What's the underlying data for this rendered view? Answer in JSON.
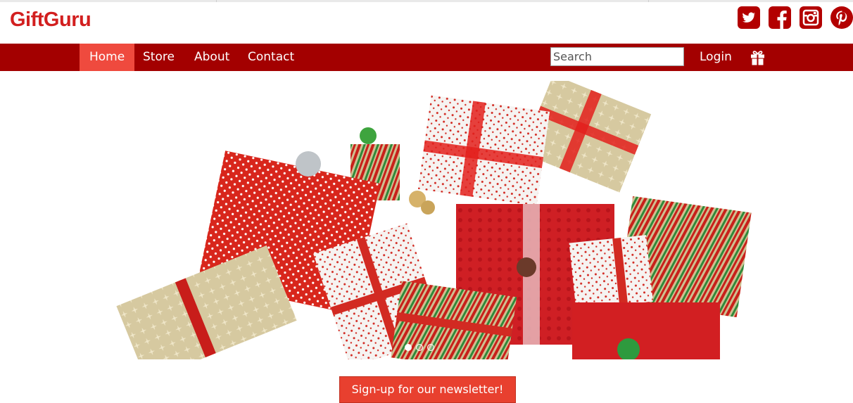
{
  "brand": {
    "name": "GiftGuru",
    "color": "#d21f1f"
  },
  "social": [
    {
      "name": "twitter-icon"
    },
    {
      "name": "facebook-icon"
    },
    {
      "name": "instagram-icon"
    },
    {
      "name": "pinterest-icon"
    }
  ],
  "nav": {
    "items": [
      {
        "label": "Home",
        "active": true
      },
      {
        "label": "Store",
        "active": false
      },
      {
        "label": "About",
        "active": false
      },
      {
        "label": "Contact",
        "active": false
      }
    ],
    "search_placeholder": "Search",
    "login_label": "Login",
    "bar_color": "#a30000",
    "active_color": "#ef4a3e"
  },
  "hero": {
    "slides": 3,
    "active_slide": 1
  },
  "newsletter": {
    "label": "Sign-up for our newsletter!"
  }
}
